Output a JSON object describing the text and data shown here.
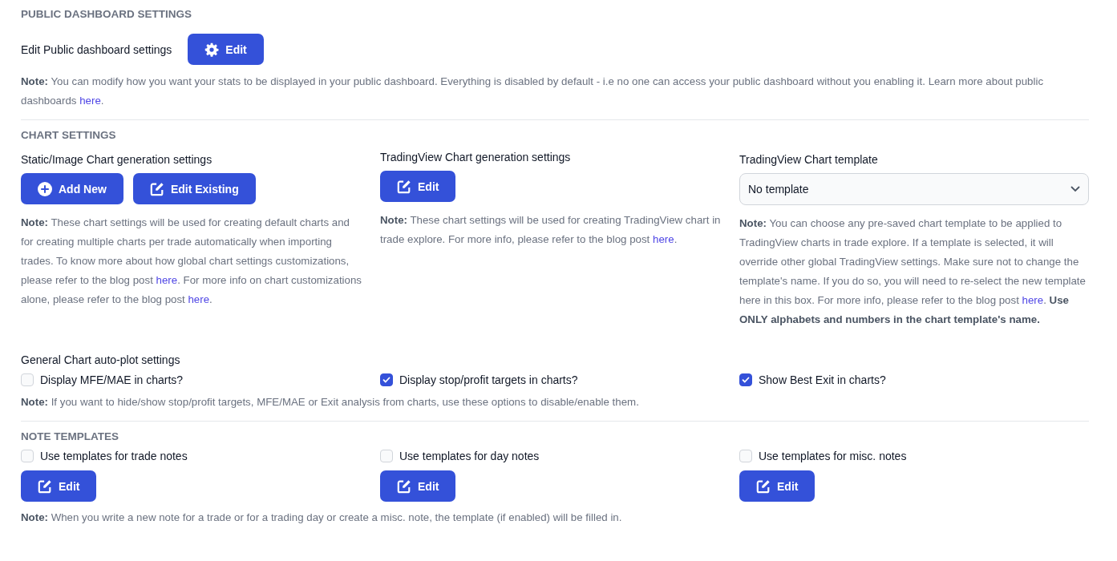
{
  "public_dashboard": {
    "heading": "PUBLIC DASHBOARD SETTINGS",
    "label": "Edit Public dashboard settings",
    "button": {
      "label": "Edit",
      "kind": "gear"
    },
    "note": [
      {
        "kind": "text",
        "text": "**Note:** You can modify how you want your stats to be displayed in your public dashboard. Everything is disabled by default - i.e no one can access your public dashboard without you enabling it. Learn more about public dashboards "
      },
      {
        "kind": "link",
        "text": "here"
      },
      {
        "kind": "text",
        "text": "."
      }
    ]
  },
  "chart_settings": {
    "heading": "CHART SETTINGS",
    "columns": [
      {
        "title": "Static/Image Chart generation settings",
        "buttons": [
          {
            "label": "Add New",
            "kind": "plus"
          },
          {
            "label": "Edit Existing",
            "kind": "edit"
          }
        ],
        "note": [
          {
            "kind": "text",
            "text": "**Note:** These chart settings will be used for creating default charts and for creating multiple charts per trade automatically when importing trades. To know more about how global chart settings customizations, please refer to the blog post "
          },
          {
            "kind": "link",
            "text": "here"
          },
          {
            "kind": "text",
            "text": ". For more info on chart customizations alone, please refer to the blog post "
          },
          {
            "kind": "link",
            "text": "here"
          },
          {
            "kind": "text",
            "text": "."
          }
        ]
      },
      {
        "title": "TradingView Chart generation settings",
        "buttons": [
          {
            "label": "Edit",
            "kind": "edit"
          }
        ],
        "note": [
          {
            "kind": "text",
            "text": "**Note:** These chart settings will be used for creating TradingView chart in trade explore. For more info, please refer to the blog post "
          },
          {
            "kind": "link",
            "text": "here"
          },
          {
            "kind": "text",
            "text": "."
          }
        ]
      },
      {
        "title": "TradingView Chart template",
        "select": {
          "value": "No template"
        },
        "note": [
          {
            "kind": "text",
            "text": "**Note:** You can choose any pre-saved chart template to be applied to TradingView charts in trade explore. If a template is selected, it will override other global TradingView settings. Make sure not to change the template's name. If you do so, you will need to re-select the new template here in this box. For more info, please refer to the blog post "
          },
          {
            "kind": "link",
            "text": "here"
          },
          {
            "kind": "text",
            "text": ". **Use ONLY alphabets and numbers in the chart template's name.**"
          }
        ]
      }
    ]
  },
  "auto_plot": {
    "title": "General Chart auto-plot settings",
    "options": [
      {
        "label": "Display MFE/MAE in charts?",
        "checked": false
      },
      {
        "label": "Display stop/profit targets in charts?",
        "checked": true
      },
      {
        "label": "Show Best Exit in charts?",
        "checked": true
      }
    ],
    "note": [
      {
        "kind": "text",
        "text": "**Note:** If you want to hide/show stop/profit targets, MFE/MAE or Exit analysis from charts, use these options to disable/enable them."
      }
    ]
  },
  "note_templates": {
    "heading": "NOTE TEMPLATES",
    "items": [
      {
        "label": "Use templates for trade notes",
        "checked": false,
        "button": {
          "label": "Edit",
          "kind": "edit"
        }
      },
      {
        "label": "Use templates for day notes",
        "checked": false,
        "button": {
          "label": "Edit",
          "kind": "edit"
        }
      },
      {
        "label": "Use templates for misc. notes",
        "checked": false,
        "button": {
          "label": "Edit",
          "kind": "edit"
        }
      }
    ],
    "note": [
      {
        "kind": "text",
        "text": "**Note:** When you write a new note for a trade or for a trading day or create a misc. note, the template (if enabled) will be filled in."
      }
    ]
  }
}
